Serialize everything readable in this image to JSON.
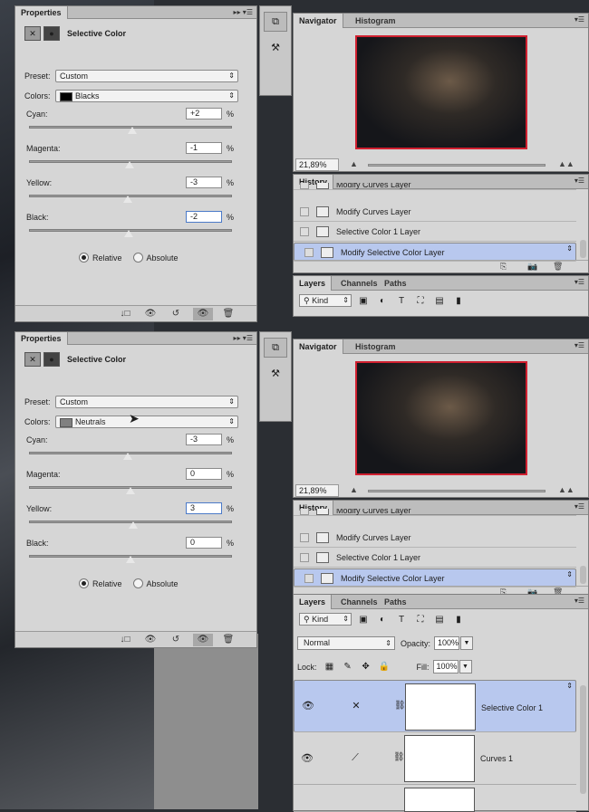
{
  "panels": [
    {
      "properties": {
        "tab": "Properties",
        "title": "Selective Color",
        "preset_label": "Preset:",
        "preset_value": "Custom",
        "colors_label": "Colors:",
        "colors_value": "Blacks",
        "colors_swatch": "#000000",
        "sliders": [
          {
            "label": "Cyan:",
            "value": "+2",
            "unit": "%",
            "level": 0.51
          },
          {
            "label": "Magenta:",
            "value": "-1",
            "unit": "%",
            "level": 0.495
          },
          {
            "label": "Yellow:",
            "value": "-3",
            "unit": "%",
            "level": 0.485
          },
          {
            "label": "Black:",
            "value": "-2",
            "unit": "%",
            "level": 0.49
          }
        ],
        "method_relative": "Relative",
        "method_absolute": "Absolute",
        "selected_method": "Relative",
        "focused_slider": 3
      },
      "navigator": {
        "tab1": "Navigator",
        "tab2": "Histogram",
        "zoom": "21,89%"
      },
      "history": {
        "tab": "History",
        "items": [
          "Modify Curves Layer",
          "Modify Curves Layer",
          "Selective Color 1 Layer",
          "Modify Selective Color Layer"
        ],
        "selected": 3
      },
      "layers": {
        "tab1": "Layers",
        "tab2": "Channels",
        "tab3": "Paths",
        "kind": "Kind"
      }
    },
    {
      "properties": {
        "tab": "Properties",
        "title": "Selective Color",
        "preset_label": "Preset:",
        "preset_value": "Custom",
        "colors_label": "Colors:",
        "colors_value": "Neutrals",
        "colors_swatch": "#808080",
        "sliders": [
          {
            "label": "Cyan:",
            "value": "-3",
            "unit": "%",
            "level": 0.485
          },
          {
            "label": "Magenta:",
            "value": "0",
            "unit": "%",
            "level": 0.5
          },
          {
            "label": "Yellow:",
            "value": "3",
            "unit": "%",
            "level": 0.515
          },
          {
            "label": "Black:",
            "value": "0",
            "unit": "%",
            "level": 0.5
          }
        ],
        "method_relative": "Relative",
        "method_absolute": "Absolute",
        "selected_method": "Relative",
        "focused_slider": 2
      },
      "navigator": {
        "tab1": "Navigator",
        "tab2": "Histogram",
        "zoom": "21,89%"
      },
      "history": {
        "tab": "History",
        "items": [
          "Modify Curves Layer",
          "Modify Curves Layer",
          "Selective Color 1 Layer",
          "Modify Selective Color Layer"
        ],
        "selected": 3
      },
      "layers": {
        "tab1": "Layers",
        "tab2": "Channels",
        "tab3": "Paths",
        "kind": "Kind",
        "blend_mode": "Normal",
        "opacity_label": "Opacity:",
        "opacity": "100%",
        "lock_label": "Lock:",
        "fill_label": "Fill:",
        "fill": "100%",
        "rows": [
          {
            "name": "Selective Color 1",
            "selected": true
          },
          {
            "name": "Curves 1",
            "selected": false
          }
        ]
      }
    }
  ],
  "colors": {
    "selection": "#b8c8ee",
    "nav_frame": "#d02030"
  }
}
